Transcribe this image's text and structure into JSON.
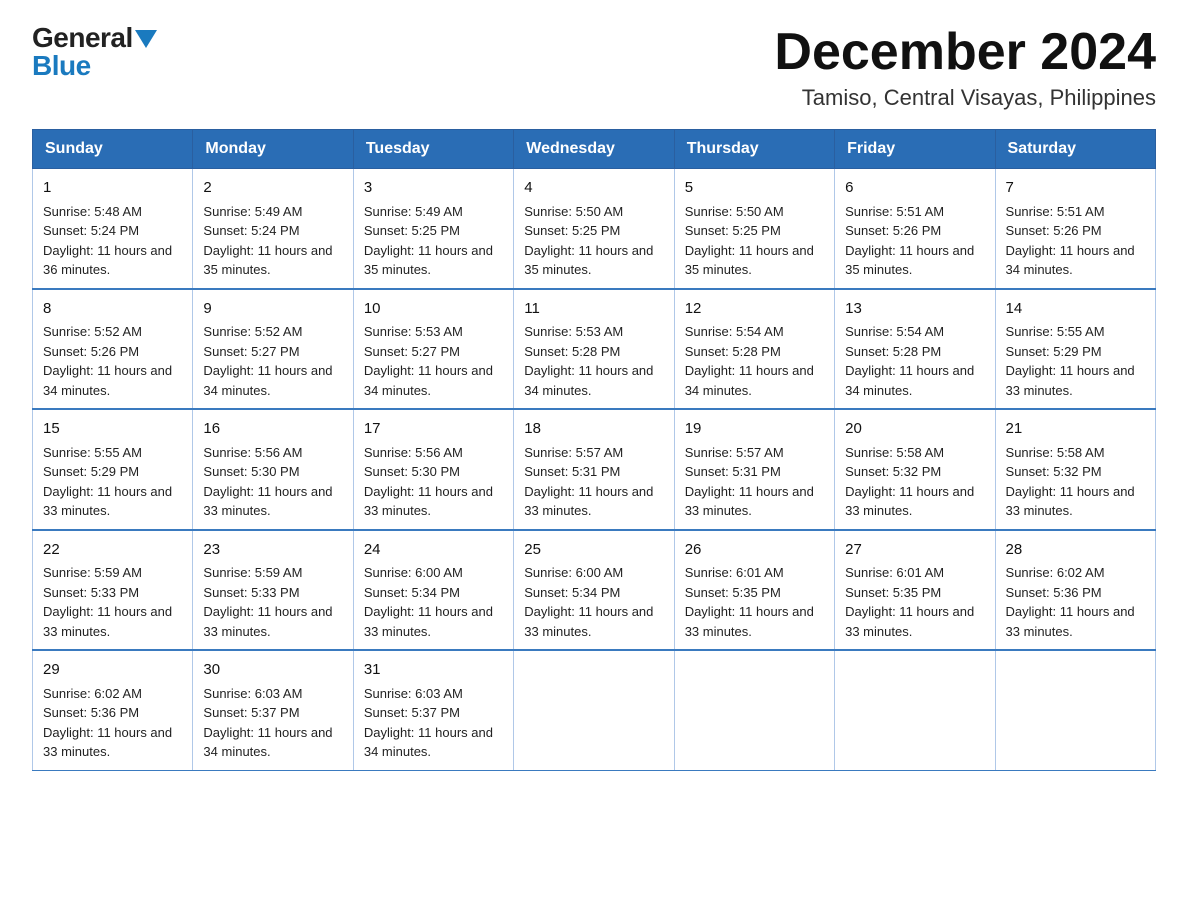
{
  "logo": {
    "general": "General",
    "blue": "Blue"
  },
  "title": "December 2024",
  "subtitle": "Tamiso, Central Visayas, Philippines",
  "weekdays": [
    "Sunday",
    "Monday",
    "Tuesday",
    "Wednesday",
    "Thursday",
    "Friday",
    "Saturday"
  ],
  "weeks": [
    [
      {
        "day": "1",
        "sunrise": "5:48 AM",
        "sunset": "5:24 PM",
        "daylight": "11 hours and 36 minutes."
      },
      {
        "day": "2",
        "sunrise": "5:49 AM",
        "sunset": "5:24 PM",
        "daylight": "11 hours and 35 minutes."
      },
      {
        "day": "3",
        "sunrise": "5:49 AM",
        "sunset": "5:25 PM",
        "daylight": "11 hours and 35 minutes."
      },
      {
        "day": "4",
        "sunrise": "5:50 AM",
        "sunset": "5:25 PM",
        "daylight": "11 hours and 35 minutes."
      },
      {
        "day": "5",
        "sunrise": "5:50 AM",
        "sunset": "5:25 PM",
        "daylight": "11 hours and 35 minutes."
      },
      {
        "day": "6",
        "sunrise": "5:51 AM",
        "sunset": "5:26 PM",
        "daylight": "11 hours and 35 minutes."
      },
      {
        "day": "7",
        "sunrise": "5:51 AM",
        "sunset": "5:26 PM",
        "daylight": "11 hours and 34 minutes."
      }
    ],
    [
      {
        "day": "8",
        "sunrise": "5:52 AM",
        "sunset": "5:26 PM",
        "daylight": "11 hours and 34 minutes."
      },
      {
        "day": "9",
        "sunrise": "5:52 AM",
        "sunset": "5:27 PM",
        "daylight": "11 hours and 34 minutes."
      },
      {
        "day": "10",
        "sunrise": "5:53 AM",
        "sunset": "5:27 PM",
        "daylight": "11 hours and 34 minutes."
      },
      {
        "day": "11",
        "sunrise": "5:53 AM",
        "sunset": "5:28 PM",
        "daylight": "11 hours and 34 minutes."
      },
      {
        "day": "12",
        "sunrise": "5:54 AM",
        "sunset": "5:28 PM",
        "daylight": "11 hours and 34 minutes."
      },
      {
        "day": "13",
        "sunrise": "5:54 AM",
        "sunset": "5:28 PM",
        "daylight": "11 hours and 34 minutes."
      },
      {
        "day": "14",
        "sunrise": "5:55 AM",
        "sunset": "5:29 PM",
        "daylight": "11 hours and 33 minutes."
      }
    ],
    [
      {
        "day": "15",
        "sunrise": "5:55 AM",
        "sunset": "5:29 PM",
        "daylight": "11 hours and 33 minutes."
      },
      {
        "day": "16",
        "sunrise": "5:56 AM",
        "sunset": "5:30 PM",
        "daylight": "11 hours and 33 minutes."
      },
      {
        "day": "17",
        "sunrise": "5:56 AM",
        "sunset": "5:30 PM",
        "daylight": "11 hours and 33 minutes."
      },
      {
        "day": "18",
        "sunrise": "5:57 AM",
        "sunset": "5:31 PM",
        "daylight": "11 hours and 33 minutes."
      },
      {
        "day": "19",
        "sunrise": "5:57 AM",
        "sunset": "5:31 PM",
        "daylight": "11 hours and 33 minutes."
      },
      {
        "day": "20",
        "sunrise": "5:58 AM",
        "sunset": "5:32 PM",
        "daylight": "11 hours and 33 minutes."
      },
      {
        "day": "21",
        "sunrise": "5:58 AM",
        "sunset": "5:32 PM",
        "daylight": "11 hours and 33 minutes."
      }
    ],
    [
      {
        "day": "22",
        "sunrise": "5:59 AM",
        "sunset": "5:33 PM",
        "daylight": "11 hours and 33 minutes."
      },
      {
        "day": "23",
        "sunrise": "5:59 AM",
        "sunset": "5:33 PM",
        "daylight": "11 hours and 33 minutes."
      },
      {
        "day": "24",
        "sunrise": "6:00 AM",
        "sunset": "5:34 PM",
        "daylight": "11 hours and 33 minutes."
      },
      {
        "day": "25",
        "sunrise": "6:00 AM",
        "sunset": "5:34 PM",
        "daylight": "11 hours and 33 minutes."
      },
      {
        "day": "26",
        "sunrise": "6:01 AM",
        "sunset": "5:35 PM",
        "daylight": "11 hours and 33 minutes."
      },
      {
        "day": "27",
        "sunrise": "6:01 AM",
        "sunset": "5:35 PM",
        "daylight": "11 hours and 33 minutes."
      },
      {
        "day": "28",
        "sunrise": "6:02 AM",
        "sunset": "5:36 PM",
        "daylight": "11 hours and 33 minutes."
      }
    ],
    [
      {
        "day": "29",
        "sunrise": "6:02 AM",
        "sunset": "5:36 PM",
        "daylight": "11 hours and 33 minutes."
      },
      {
        "day": "30",
        "sunrise": "6:03 AM",
        "sunset": "5:37 PM",
        "daylight": "11 hours and 34 minutes."
      },
      {
        "day": "31",
        "sunrise": "6:03 AM",
        "sunset": "5:37 PM",
        "daylight": "11 hours and 34 minutes."
      },
      null,
      null,
      null,
      null
    ]
  ]
}
